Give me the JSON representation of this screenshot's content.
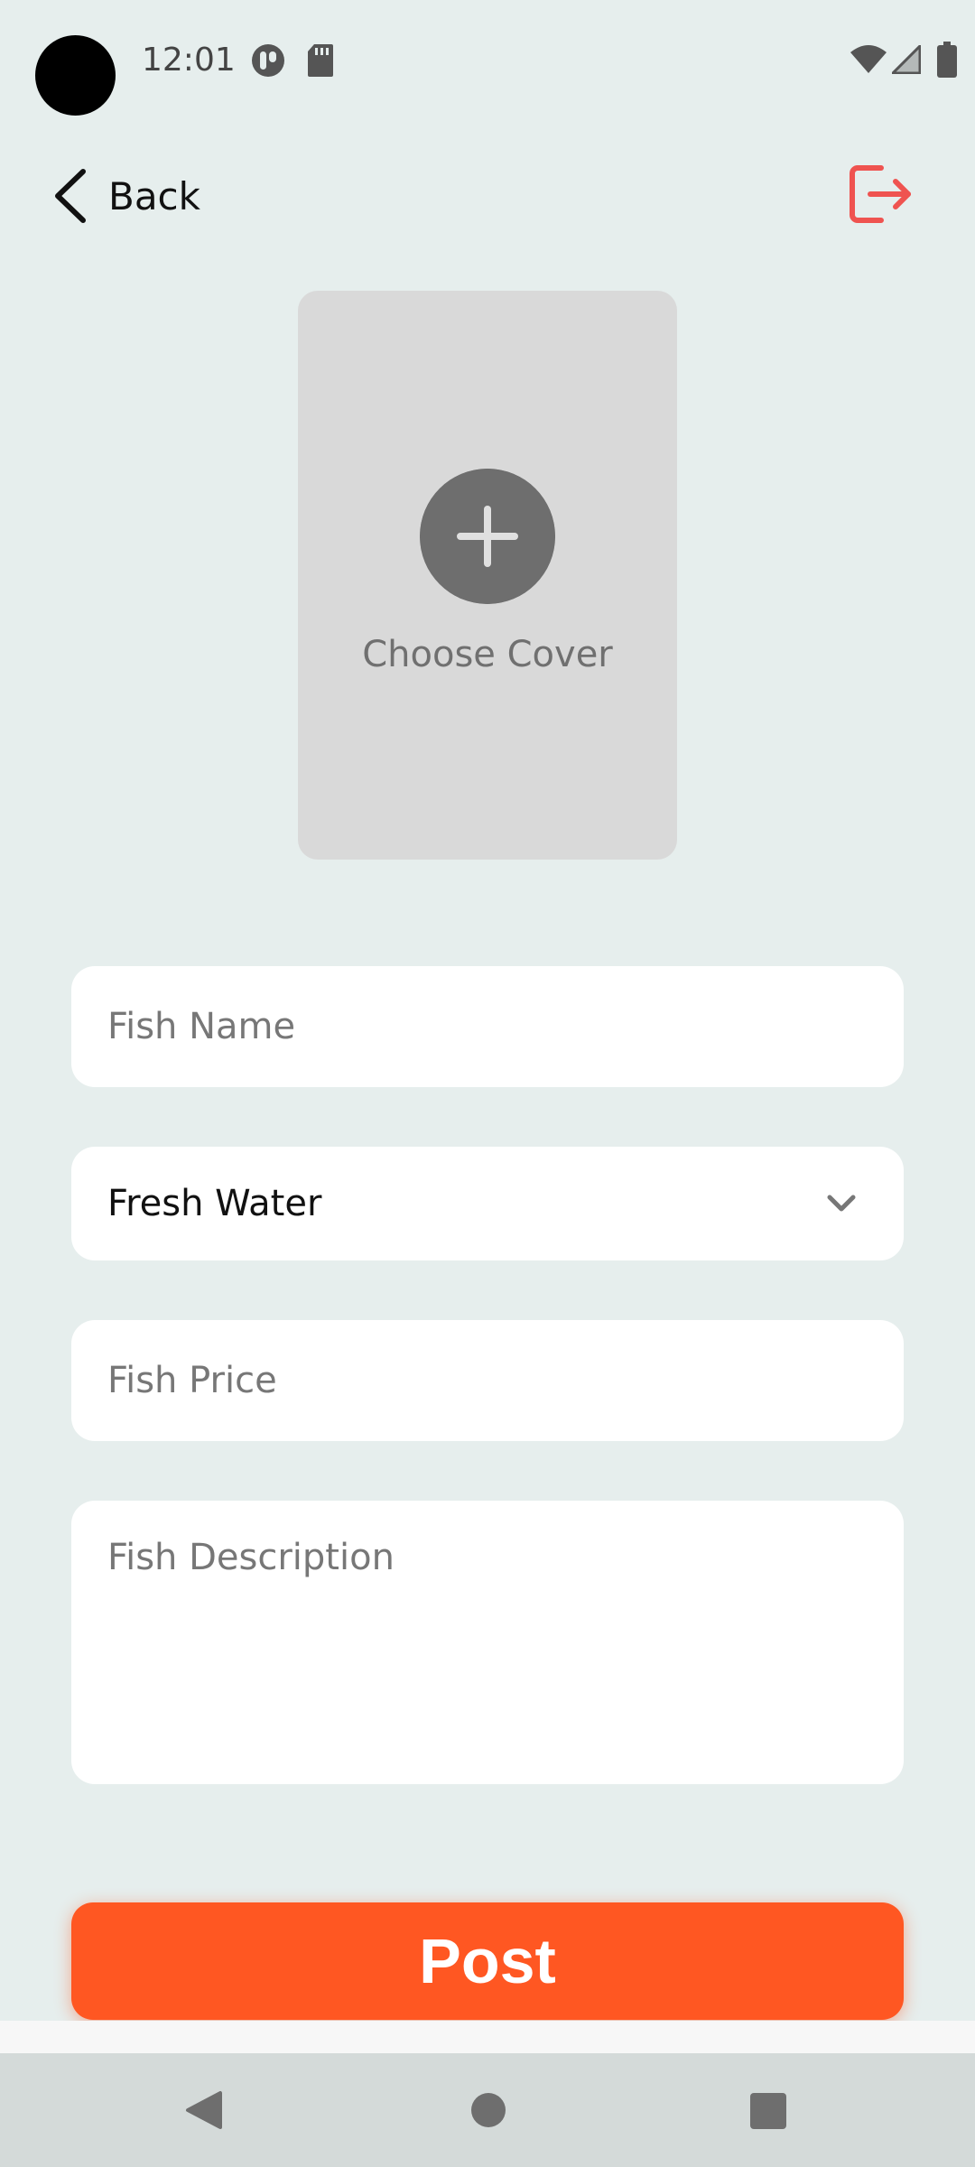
{
  "status_bar": {
    "time": "12:01",
    "icons": [
      "notification-app-icon",
      "sd-card-icon",
      "wifi-icon",
      "cellular-signal-icon",
      "battery-icon"
    ]
  },
  "app_bar": {
    "back_label": "Back",
    "logout_icon": "logout-icon",
    "logout_color": "#ef5350"
  },
  "cover": {
    "label": "Choose Cover",
    "icon": "plus-icon"
  },
  "form": {
    "fish_name_placeholder": "Fish Name",
    "fish_name_value": "",
    "water_type_selected": "Fresh Water",
    "fish_price_placeholder": "Fish Price",
    "fish_price_value": "",
    "fish_description_placeholder": "Fish Description",
    "fish_description_value": ""
  },
  "actions": {
    "post_label": "Post",
    "post_color": "#ff5722"
  },
  "nav_bar": {
    "icons": [
      "nav-back-icon",
      "nav-home-icon",
      "nav-recents-icon"
    ]
  }
}
